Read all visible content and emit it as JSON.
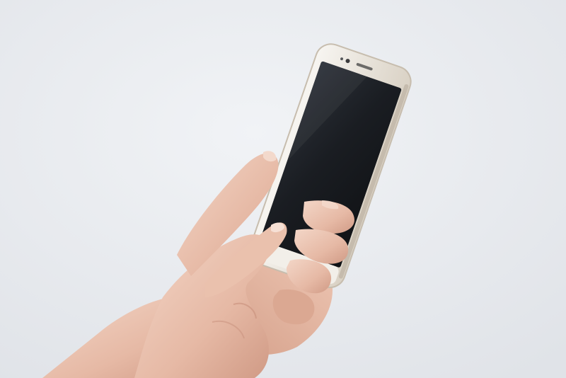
{
  "scene": {
    "subject": "hands-holding-smartphone",
    "colors": {
      "background_light": "#eef0f4",
      "background_mid": "#e3e6eb",
      "skin_light": "#f0cfbf",
      "skin_mid": "#e2b39e",
      "skin_shadow": "#c98e7a",
      "phone_frame": "#f4f1ec",
      "phone_edge": "#cfc6b8",
      "screen_dark": "#15181d",
      "screen_highlight": "#3a4048"
    }
  }
}
